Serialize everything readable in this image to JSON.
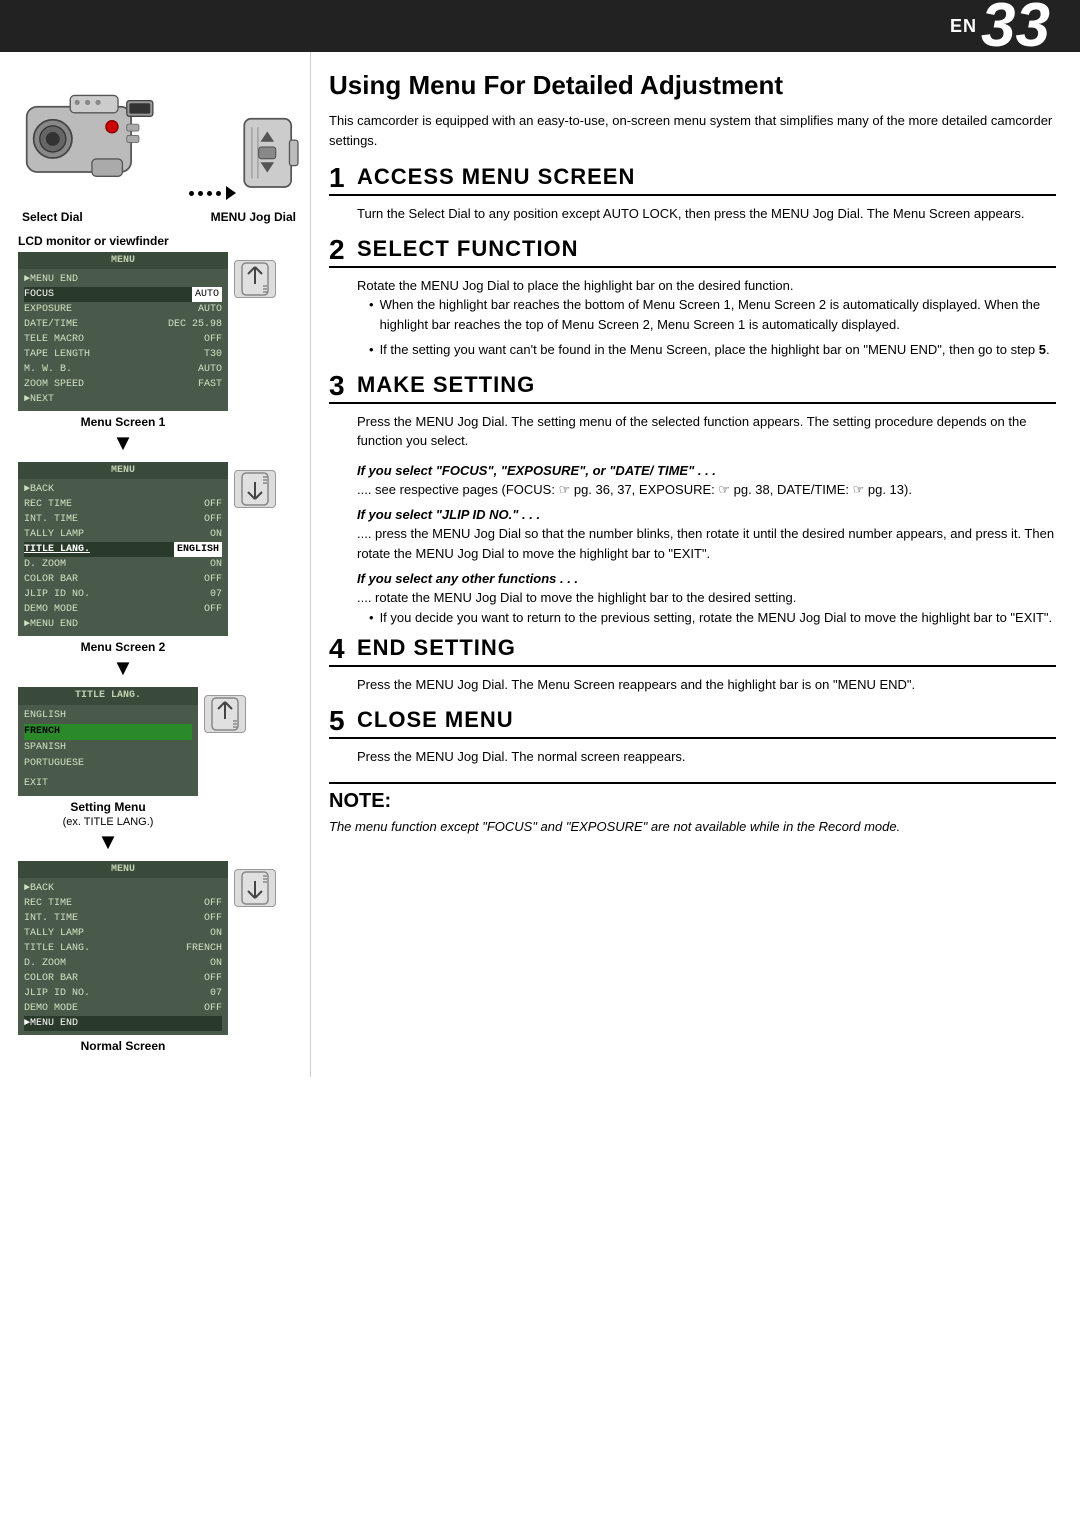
{
  "header": {
    "en_label": "EN",
    "page_num": "33"
  },
  "left_col": {
    "camcorder_alt": "Camcorder",
    "jog_dial_alt": "MENU Jog Dial",
    "select_dial_label": "Select Dial",
    "menu_jog_dial_label": "MENU Jog Dial",
    "lcd_label": "LCD monitor or viewfinder",
    "menu_screen_1_label": "Menu Screen 1",
    "menu_screen_2_label": "Menu Screen 2",
    "setting_menu_label": "Setting Menu",
    "setting_menu_sub": "(ex. TITLE LANG.)",
    "normal_screen_label": "Normal Screen",
    "menu1": {
      "title": "MENU",
      "rows": [
        {
          "arrow": "►",
          "label": "MENU END",
          "value": ""
        },
        {
          "arrow": "",
          "label": "FOCUS",
          "value": "AUTO",
          "highlighted_label": true
        },
        {
          "arrow": "",
          "label": "EXPOSURE",
          "value": "AUTO"
        },
        {
          "arrow": "",
          "label": "DATE/TIME",
          "value": "DEC 25.98"
        },
        {
          "arrow": "",
          "label": "TELE MACRO",
          "value": "OFF"
        },
        {
          "arrow": "",
          "label": "TAPE LENGTH",
          "value": "T30"
        },
        {
          "arrow": "",
          "label": "M. W. B.",
          "value": "AUTO"
        },
        {
          "arrow": "",
          "label": "ZOOM SPEED",
          "value": "FAST"
        },
        {
          "arrow": "►",
          "label": "NEXT",
          "value": ""
        }
      ]
    },
    "menu2": {
      "title": "MENU",
      "rows": [
        {
          "arrow": "►",
          "label": "BACK",
          "value": ""
        },
        {
          "arrow": "",
          "label": "REC TIME",
          "value": "OFF"
        },
        {
          "arrow": "",
          "label": "INT. TIME",
          "value": "OFF"
        },
        {
          "arrow": "",
          "label": "TALLY LAMP",
          "value": "ON"
        },
        {
          "arrow": "",
          "label": "TITLE LANG.",
          "value": "ENGLISH",
          "highlighted_label": true,
          "highlighted_val": true
        },
        {
          "arrow": "",
          "label": "D. ZOOM",
          "value": "ON"
        },
        {
          "arrow": "",
          "label": "COLOR BAR",
          "value": "OFF"
        },
        {
          "arrow": "",
          "label": "JLIP ID NO.",
          "value": "07"
        },
        {
          "arrow": "",
          "label": "DEMO MODE",
          "value": "OFF"
        },
        {
          "arrow": "►",
          "label": "MENU END",
          "value": ""
        }
      ]
    },
    "setting_menu": {
      "title": "TITLE LANG.",
      "items": [
        "ENGLISH",
        "FRENCH",
        "SPANISH",
        "PORTUGUESE",
        "",
        "EXIT"
      ],
      "highlighted": "FRENCH"
    },
    "final_menu": {
      "title": "MENU",
      "rows": [
        {
          "arrow": "►",
          "label": "BACK",
          "value": ""
        },
        {
          "arrow": "",
          "label": "REC TIME",
          "value": "OFF"
        },
        {
          "arrow": "",
          "label": "INT. TIME",
          "value": "OFF"
        },
        {
          "arrow": "",
          "label": "TALLY LAMP",
          "value": "ON"
        },
        {
          "arrow": "",
          "label": "TITLE LANG.",
          "value": "FRENCH"
        },
        {
          "arrow": "",
          "label": "D. ZOOM",
          "value": "ON"
        },
        {
          "arrow": "",
          "label": "COLOR BAR",
          "value": "OFF"
        },
        {
          "arrow": "",
          "label": "JLIP ID NO.",
          "value": "07"
        },
        {
          "arrow": "",
          "label": "DEMO MODE",
          "value": "OFF"
        },
        {
          "arrow": "►",
          "label": "MENU END",
          "value": "",
          "highlighted_label": true
        }
      ]
    }
  },
  "right_col": {
    "page_title": "Using Menu For Detailed Adjustment",
    "intro": "This camcorder is equipped with an easy-to-use, on-screen menu system that simplifies many of the more detailed camcorder settings.",
    "sections": [
      {
        "step": "1",
        "title": "Access Menu Screen",
        "body": "Turn the Select Dial to any position except AUTO LOCK, then press the MENU Jog Dial. The Menu Screen appears.",
        "bullets": [],
        "if_selects": []
      },
      {
        "step": "2",
        "title": "Select Function",
        "body": "Rotate the MENU Jog Dial to place the highlight bar on the desired function.",
        "bullets": [
          "When the highlight bar reaches the bottom of Menu Screen 1, Menu Screen 2 is automatically displayed. When the highlight bar reaches the top of Menu Screen 2, Menu Screen 1 is automatically displayed.",
          "If the setting you want can't be found in the Menu Screen, place the highlight bar on \"MENU END\", then go to step 5."
        ],
        "if_selects": []
      },
      {
        "step": "3",
        "title": "Make Setting",
        "body": "Press the MENU Jog Dial. The setting menu of the selected function appears. The setting procedure depends on the function you select.",
        "bullets": [],
        "if_selects": [
          {
            "header": "If you select \"FOCUS\", \"EXPOSURE\", or \"DATE/ TIME\" . . .",
            "body": ".... see respective pages (FOCUS: ☞ pg. 36, 37, EXPOSURE: ☞ pg. 38, DATE/TIME: ☞ pg. 13)."
          },
          {
            "header": "If you select \"JLIP ID NO.\" . . .",
            "body": ".... press the MENU Jog Dial so that the number blinks, then rotate it until the desired number appears, and press it. Then rotate the MENU Jog Dial to move the highlight bar to \"EXIT\"."
          },
          {
            "header": "If you select any other functions . . .",
            "body": ".... rotate the MENU Jog Dial to move the highlight bar to the desired setting.",
            "sub_bullet": "If you decide you want to return to the previous setting, rotate the MENU Jog Dial to move the highlight bar to \"EXIT\"."
          }
        ]
      },
      {
        "step": "4",
        "title": "End Setting",
        "body": "Press the MENU Jog Dial. The Menu Screen reappears and the highlight bar is on \"MENU END\".",
        "bullets": [],
        "if_selects": []
      },
      {
        "step": "5",
        "title": "Close Menu",
        "body": "Press the MENU Jog Dial. The normal screen reappears.",
        "bullets": [],
        "if_selects": []
      }
    ],
    "note": {
      "title": "Note:",
      "body": "The menu function except \"FOCUS\" and \"EXPOSURE\" are not available while in the Record mode."
    }
  }
}
